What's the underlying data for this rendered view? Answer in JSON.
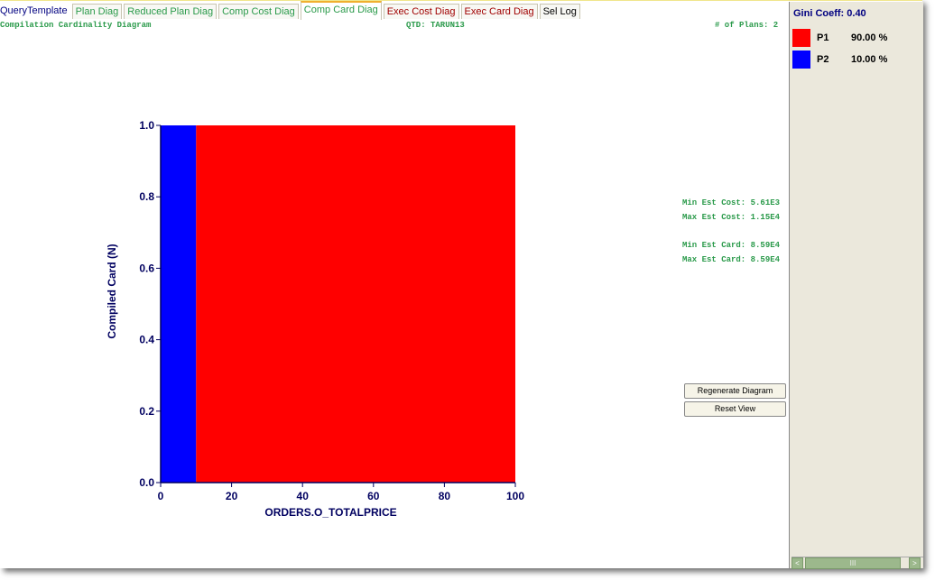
{
  "tabs": [
    {
      "label": "QueryTemplate",
      "style": "qt"
    },
    {
      "label": "Plan Diag",
      "style": "green"
    },
    {
      "label": "Reduced Plan Diag",
      "style": "green"
    },
    {
      "label": "Comp Cost Diag",
      "style": "green"
    },
    {
      "label": "Comp Card Diag",
      "style": "green active"
    },
    {
      "label": "Exec Cost Diag",
      "style": "red"
    },
    {
      "label": "Exec Card Diag",
      "style": "red"
    },
    {
      "label": "Sel Log",
      "style": "black"
    }
  ],
  "header": {
    "diagram_title": "Compilation Cardinality Diagram",
    "qtd": "QTD: TARUN13",
    "num_plans": "# of Plans: 2"
  },
  "stats": {
    "min_est_cost": "Min Est Cost: 5.61E3",
    "max_est_cost": "Max Est Cost: 1.15E4",
    "min_est_card": "Min Est Card: 8.59E4",
    "max_est_card": "Max Est Card: 8.59E4"
  },
  "buttons": {
    "regenerate": "Regenerate Diagram",
    "reset": "Reset View"
  },
  "sidepanel": {
    "gini": "Gini Coeff: 0.40",
    "legend": [
      {
        "name": "P1",
        "pct": "90.00 %",
        "color": "#ff0000"
      },
      {
        "name": "P2",
        "pct": "10.00 %",
        "color": "#0000ff"
      }
    ],
    "scroll_left": "<",
    "scroll_right": ">",
    "scroll_grip": "III"
  },
  "chart_data": {
    "type": "heatmap",
    "title": "Compilation Cardinality Diagram",
    "xlabel": "ORDERS.O_TOTALPRICE",
    "ylabel": "Compiled Card (N)",
    "xlim": [
      0,
      100
    ],
    "ylim": [
      0.0,
      1.0
    ],
    "xticks": [
      "0",
      "20",
      "40",
      "60",
      "80",
      "100"
    ],
    "yticks": [
      "0.0",
      "0.2",
      "0.4",
      "0.6",
      "0.8",
      "1.0"
    ],
    "regions": [
      {
        "plan": "P2",
        "x_from": 0,
        "x_to": 10,
        "y_from": 0.0,
        "y_to": 1.0,
        "color": "#0000ff"
      },
      {
        "plan": "P1",
        "x_from": 10,
        "x_to": 100,
        "y_from": 0.0,
        "y_to": 1.0,
        "color": "#ff0000"
      }
    ],
    "grid": false,
    "legend": "right"
  }
}
